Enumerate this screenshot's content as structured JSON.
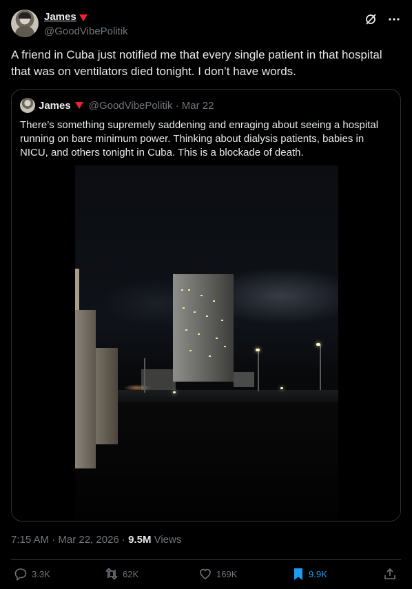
{
  "author": {
    "name": "James",
    "handle": "@GoodVibePolitik"
  },
  "tweet": {
    "text": "A friend in Cuba just notified me that every single patient in that hospital that was on ventilators died tonight. I don’t have words."
  },
  "quoted": {
    "name": "James",
    "handle_date": "@GoodVibePolitik · Mar 22",
    "text": "There’s something supremely saddening and enraging about seeing a hospital running on bare minimum power. Thinking about dialysis patients, babies in NICU, and others tonight in Cuba. This is a blockade of death."
  },
  "meta": {
    "time_date": "7:15 AM · Mar 22, 2026 · ",
    "views_count": "9.5M",
    "views_label": " Views"
  },
  "actions": {
    "replies": "3.3K",
    "reposts": "62K",
    "likes": "169K",
    "bookmarks": "9.9K"
  },
  "icons": {
    "grok": "grok-icon",
    "more": "more-icon",
    "reply": "reply-icon",
    "repost": "repost-icon",
    "like": "heart-icon",
    "bookmark": "bookmark-icon",
    "share": "share-icon"
  },
  "colors": {
    "background": "#000000",
    "text": "#e7e9ea",
    "muted": "#71767b",
    "accent": "#1d9bf0",
    "badge": "#f4212e",
    "border": "#2f3336"
  }
}
